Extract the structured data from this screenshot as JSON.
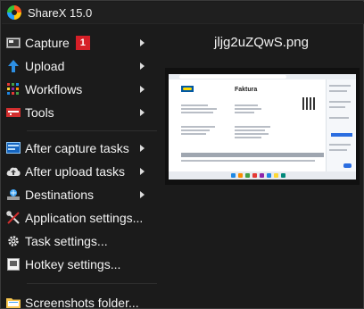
{
  "window": {
    "title": "ShareX 15.0",
    "icon": "sharex-logo-icon"
  },
  "menu": [
    {
      "id": "capture",
      "label": "Capture",
      "icon": "capture-icon",
      "badge": "1",
      "submenu": true
    },
    {
      "id": "upload",
      "label": "Upload",
      "icon": "upload-arrow-icon",
      "submenu": true
    },
    {
      "id": "workflows",
      "label": "Workflows",
      "icon": "workflows-grid-icon",
      "submenu": true
    },
    {
      "id": "tools",
      "label": "Tools",
      "icon": "tools-icon",
      "submenu": true
    },
    {
      "id": "after-capture-tasks",
      "label": "After capture tasks",
      "icon": "after-capture-icon",
      "submenu": true
    },
    {
      "id": "after-upload-tasks",
      "label": "After upload tasks",
      "icon": "cloud-upload-icon",
      "submenu": true
    },
    {
      "id": "destinations",
      "label": "Destinations",
      "icon": "destinations-icon",
      "submenu": true
    },
    {
      "id": "application-settings",
      "label": "Application settings...",
      "icon": "wrench-screwdriver-icon",
      "submenu": false
    },
    {
      "id": "task-settings",
      "label": "Task settings...",
      "icon": "gear-icon",
      "submenu": false
    },
    {
      "id": "hotkey-settings",
      "label": "Hotkey settings...",
      "icon": "keyboard-icon",
      "submenu": false
    },
    {
      "id": "screenshots-folder",
      "label": "Screenshots folder...",
      "icon": "folder-icon",
      "submenu": false
    }
  ],
  "preview": {
    "filename": "jljg2uZQwS.png",
    "thumbnail": {
      "heading": "Faktura"
    }
  },
  "colors": {
    "badge": "#d61f27",
    "background": "#1b1b1b",
    "text": "#f2f2f2"
  }
}
